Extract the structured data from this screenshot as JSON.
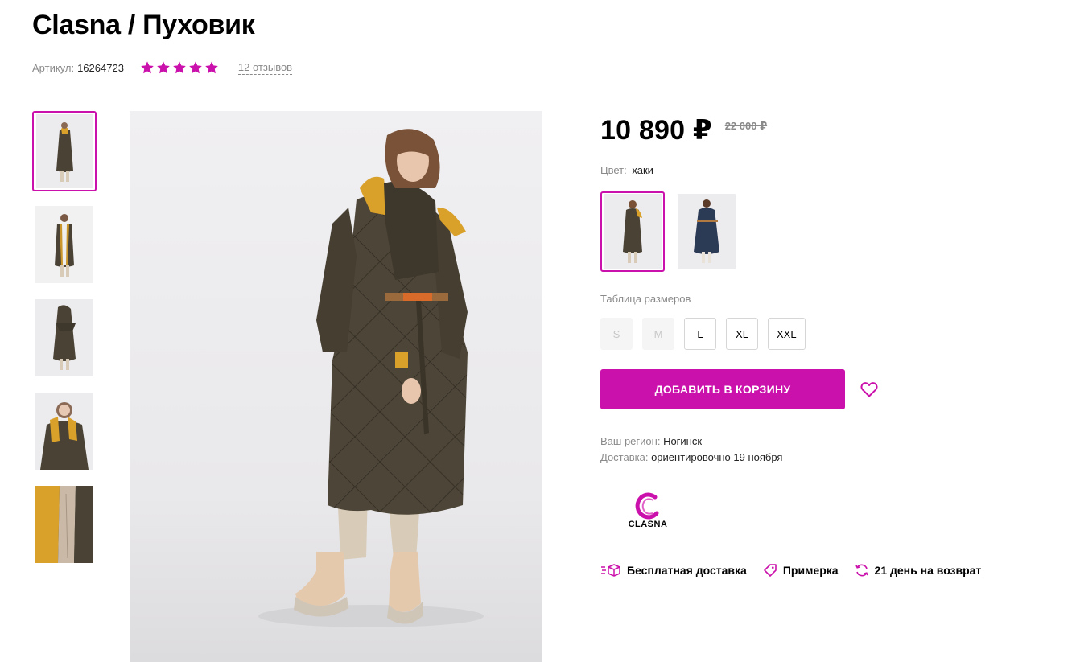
{
  "product": {
    "title": "Clasna / Пуховик",
    "sku_label": "Артикул:",
    "sku": "16264723",
    "rating": 5,
    "reviews": "12 отзывов"
  },
  "price": {
    "current": "10 890 ₽",
    "old": "22 000 ₽"
  },
  "color": {
    "label": "Цвет:",
    "value": "хаки"
  },
  "size_table_link": "Таблица размеров",
  "sizes": [
    {
      "label": "S",
      "available": false
    },
    {
      "label": "M",
      "available": false
    },
    {
      "label": "L",
      "available": true
    },
    {
      "label": "XL",
      "available": true
    },
    {
      "label": "XXL",
      "available": true
    }
  ],
  "cart": {
    "label": "ДОБАВИТЬ В КОРЗИНУ"
  },
  "delivery": {
    "region_label": "Ваш регион:",
    "region": "Ногинск",
    "date_label": "Доставка:",
    "date": "ориентировочно 19 ноября"
  },
  "brand": {
    "name": "CLASNA"
  },
  "features": [
    {
      "icon": "delivery-box-icon",
      "label": "Бесплатная доставка"
    },
    {
      "icon": "tag-icon",
      "label": "Примерка"
    },
    {
      "icon": "refresh-icon",
      "label": "21 день на возврат"
    }
  ],
  "colors": {
    "accent": "#cb11ab",
    "coat_khaki": "#4a4335",
    "coat_navy": "#2b3a55",
    "lining_mustard": "#d9a02a"
  }
}
